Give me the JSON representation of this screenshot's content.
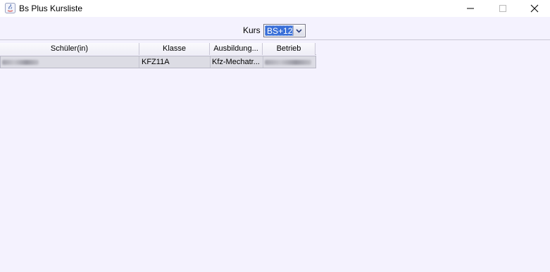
{
  "window": {
    "title": "Bs Plus Kursliste",
    "icon": "java-icon"
  },
  "kurs": {
    "label": "Kurs",
    "selected": "BS+12"
  },
  "table": {
    "columns": [
      "Schüler(in)",
      "Klasse",
      "Ausbildung...",
      "Betrieb"
    ],
    "rows": [
      {
        "schueler": "",
        "klasse": "KFZ11A",
        "ausbildung": "Kfz-Mechatr...",
        "betrieb": ""
      }
    ]
  }
}
